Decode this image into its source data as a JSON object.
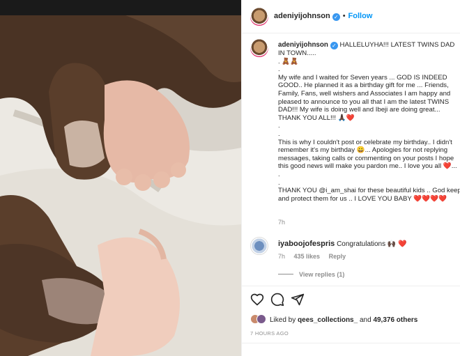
{
  "post": {
    "author": "adeniyijohnson",
    "follow_label": "Follow",
    "dot": "•",
    "verified_glyph": "✓"
  },
  "caption": {
    "username": "adeniyijohnson",
    "text": "HALLELUYHA!!! LATEST TWINS DAD IN TOWN.....\n. 🧸🧸\n.\nMy wife and I waited for Seven years ... GOD IS INDEED GOOD.. He planned it as a birthday gift for me ... Friends, Family, Fans, well wishers and Associates I am happy and pleased to announce to you all that I am the latest TWINS DAD!!! My wife is doing well and Ibeji are doing great... THANK YOU ALL!!! 🙏🏿❤️\n.\n.\nThis is why I couldn't post or celebrate my birthday.. I didn't remember it's my birthday 😀... Apologies for not replying messages, taking calls or commenting on your posts I hope this good news will make you pardon me.. I love you all ❤️...\n.\n.\nTHANK YOU @i_am_shai for these beautiful kids .. God keep and protect them for us .. I LOVE YOU BABY ❤️❤️❤️❤️",
    "time": "7h"
  },
  "comment": {
    "username": "iyaboojofespris",
    "text": "Congratulations 🙌🏿 ❤️",
    "time": "7h",
    "likes": "435 likes",
    "reply_label": "Reply",
    "view_replies": "View replies (1)"
  },
  "likes": {
    "prefix": "Liked by ",
    "user": "qees_collections_",
    "middle": " and ",
    "count": "49,376 others"
  },
  "posted": "7 HOURS AGO",
  "icons": [
    "heart-icon",
    "comment-icon",
    "share-icon"
  ],
  "colors": {
    "link": "#0095f6",
    "verified": "#3897f0",
    "secondary": "#8e8e8e",
    "border": "#efefef"
  }
}
